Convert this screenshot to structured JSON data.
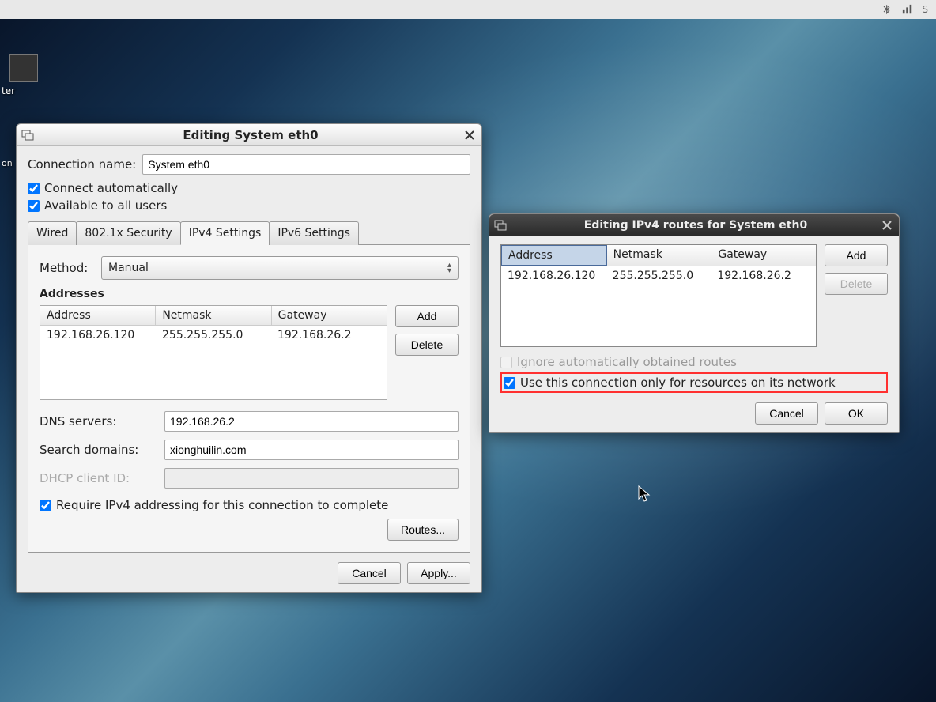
{
  "desktop": {
    "icon_label": "ter"
  },
  "panel": {
    "bluetooth": "bluetooth-icon",
    "network": "network-icon",
    "s": "S"
  },
  "main_window": {
    "title": "Editing System eth0",
    "connection_name_label": "Connection name:",
    "connection_name_value": "System eth0",
    "connect_automatically": "Connect automatically",
    "available_to_all": "Available to all users",
    "tabs": {
      "wired": "Wired",
      "security": "802.1x Security",
      "ipv4": "IPv4 Settings",
      "ipv6": "IPv6 Settings"
    },
    "method_label": "Method:",
    "method_value": "Manual",
    "addresses_heading": "Addresses",
    "address_cols": {
      "address": "Address",
      "netmask": "Netmask",
      "gateway": "Gateway"
    },
    "address_row": {
      "address": "192.168.26.120",
      "netmask": "255.255.255.0",
      "gateway": "192.168.26.2"
    },
    "add": "Add",
    "delete": "Delete",
    "dns_label": "DNS servers:",
    "dns_value": "192.168.26.2",
    "search_label": "Search domains:",
    "search_value": "xionghuilin.com",
    "dhcp_label": "DHCP client ID:",
    "dhcp_value": "",
    "require_ipv4": "Require IPv4 addressing for this connection to complete",
    "routes_btn": "Routes...",
    "cancel": "Cancel",
    "apply": "Apply..."
  },
  "routes_dialog": {
    "title": "Editing IPv4 routes for System eth0",
    "cols": {
      "address": "Address",
      "netmask": "Netmask",
      "gateway": "Gateway"
    },
    "row": {
      "address": "192.168.26.120",
      "netmask": "255.255.255.0",
      "gateway": "192.168.26.2"
    },
    "add": "Add",
    "delete": "Delete",
    "ignore_routes": "Ignore automatically obtained routes",
    "only_network": "Use this connection only for resources on its network",
    "cancel": "Cancel",
    "ok": "OK"
  }
}
